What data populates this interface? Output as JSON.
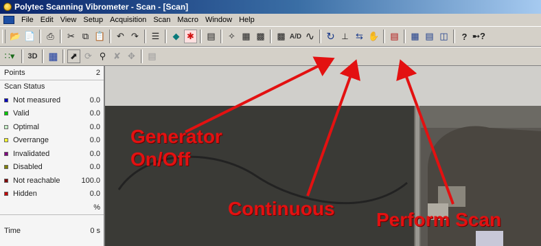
{
  "window": {
    "title": "Polytec Scanning Vibrometer - Scan - [Scan]"
  },
  "menu": [
    "File",
    "Edit",
    "View",
    "Setup",
    "Acquisition",
    "Scan",
    "Macro",
    "Window",
    "Help"
  ],
  "toolbar": {
    "ad_label": "A/D",
    "three_d_label": "3D"
  },
  "sidebar": {
    "points_label": "Points",
    "points_value": "2",
    "status_header": "Scan Status",
    "statuses": [
      {
        "label": "Not measured",
        "value": "0.0",
        "color": "#0000c0"
      },
      {
        "label": "Valid",
        "value": "0.0",
        "color": "#00cc00"
      },
      {
        "label": "Optimal",
        "value": "0.0",
        "color": "#c8f0c8"
      },
      {
        "label": "Overrange",
        "value": "0.0",
        "color": "#ffff30"
      },
      {
        "label": "Invalidated",
        "value": "0.0",
        "color": "#800080"
      },
      {
        "label": "Disabled",
        "value": "0.0",
        "color": "#808000"
      },
      {
        "label": "Not reachable",
        "value": "100.0",
        "color": "#800000"
      },
      {
        "label": "Hidden",
        "value": "0.0",
        "color": "#c00000"
      }
    ],
    "percent_unit": "%",
    "time_label": "Time",
    "time_value": "0 s"
  },
  "annotations": {
    "generator": [
      "Generator",
      "On/Off"
    ],
    "continuous": "Continuous",
    "perform_scan": "Perform Scan"
  },
  "colors": {
    "annotation": "#e31111"
  }
}
